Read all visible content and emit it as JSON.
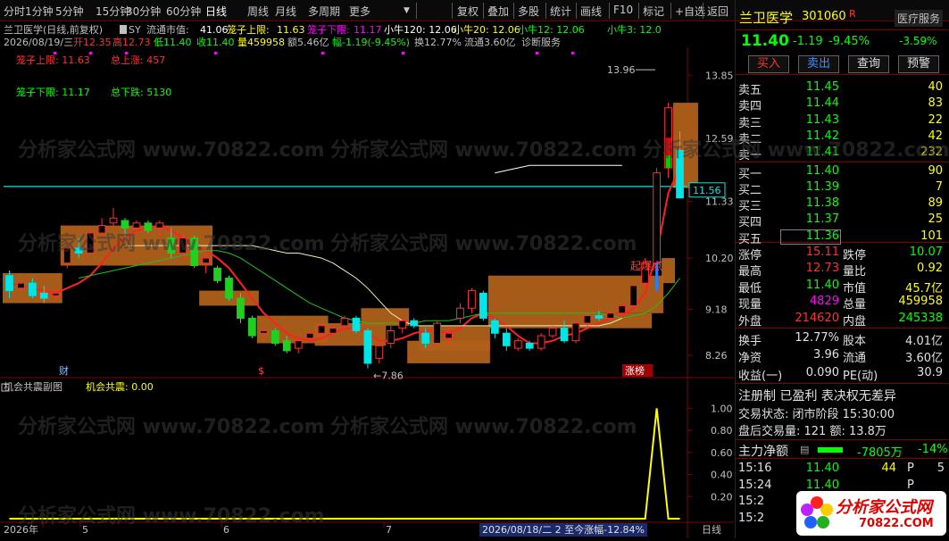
{
  "toolbar": {
    "left": [
      "分时",
      "1分钟",
      "5分钟",
      "15分钟",
      "30分钟",
      "60分钟",
      "日线",
      "周线",
      "月线",
      "多周期",
      "更多"
    ],
    "right": [
      "复权",
      "叠加",
      "多股",
      "统计",
      "画线",
      "F10",
      "标记",
      "+自选",
      "返回"
    ],
    "active": "日线"
  },
  "header": {
    "line1": {
      "name": "兰卫医学(日线,前复权)",
      "sy": "SY",
      "float_mv_label": "流通市值:",
      "float_mv": "41.06",
      "upper_label": "笼子上限:",
      "upper": "11.63",
      "lower_label": "笼子下限:",
      "lower": "11.17",
      "ma120": "小牛120: 12.06",
      "ma20": "小牛20: 12.06",
      "ma12": "小牛12: 12.06",
      "ma3": "小牛3: 12.0"
    },
    "line2": {
      "date": "2026/08/19/三",
      "open": "开12.35",
      "high": "高12.73",
      "low": "低11.40",
      "close": "收11.40",
      "vol": "量459958",
      "amt": "额5.46亿",
      "chg": "幅-1.19(-9.45%)",
      "turn": "换12.77%",
      "float": "流通3.60亿",
      "diag": "诊断服务"
    },
    "line3": {
      "upper_label": "笼子上限: 11.63",
      "up_total": "总上涨: 457"
    },
    "line4": {
      "lower_label": "笼子下限: 11.17",
      "down_total": "总下跌: 5130"
    }
  },
  "chart_data": [
    {
      "type": "candlestick",
      "title": "兰卫医学(日线,前复权)",
      "ylim": [
        7.6,
        14.3
      ],
      "y_ticks": [
        "13.85",
        "12.59",
        "11.33",
        "10.20",
        "9.18",
        "8.26"
      ],
      "price_marker": "11.56",
      "annotations": {
        "high_label": "13.96",
        "low_label": "7.86",
        "breakout": "起爆点",
        "bottom_labels": [
          "财",
          "$",
          "涨榜"
        ]
      },
      "candles": [
        {
          "o": 9.85,
          "h": 9.95,
          "l": 9.4,
          "c": 9.55
        },
        {
          "o": 9.6,
          "h": 9.9,
          "l": 9.5,
          "c": 9.7
        },
        {
          "o": 9.7,
          "h": 9.8,
          "l": 9.4,
          "c": 9.45
        },
        {
          "o": 9.5,
          "h": 9.65,
          "l": 9.3,
          "c": 9.4
        },
        {
          "o": 9.45,
          "h": 9.6,
          "l": 9.35,
          "c": 9.5
        },
        {
          "o": 10.1,
          "h": 10.6,
          "l": 10.0,
          "c": 10.4
        },
        {
          "o": 10.4,
          "h": 10.6,
          "l": 10.2,
          "c": 10.3
        },
        {
          "o": 10.3,
          "h": 10.8,
          "l": 10.25,
          "c": 10.7
        },
        {
          "o": 10.7,
          "h": 11.0,
          "l": 10.6,
          "c": 10.85
        },
        {
          "o": 10.9,
          "h": 11.2,
          "l": 10.8,
          "c": 11.0
        },
        {
          "o": 10.95,
          "h": 11.0,
          "l": 10.6,
          "c": 10.8
        },
        {
          "o": 10.8,
          "h": 10.95,
          "l": 10.7,
          "c": 10.9
        },
        {
          "o": 10.9,
          "h": 10.95,
          "l": 10.7,
          "c": 10.75
        },
        {
          "o": 10.8,
          "h": 10.95,
          "l": 10.65,
          "c": 10.9
        },
        {
          "o": 10.6,
          "h": 10.8,
          "l": 10.2,
          "c": 10.3
        },
        {
          "o": 10.3,
          "h": 10.7,
          "l": 10.2,
          "c": 10.6
        },
        {
          "o": 10.6,
          "h": 10.65,
          "l": 10.0,
          "c": 10.05
        },
        {
          "o": 10.1,
          "h": 10.3,
          "l": 9.9,
          "c": 10.2
        },
        {
          "o": 10.0,
          "h": 10.05,
          "l": 9.7,
          "c": 9.75
        },
        {
          "o": 9.8,
          "h": 9.85,
          "l": 9.35,
          "c": 9.4
        },
        {
          "o": 9.4,
          "h": 9.5,
          "l": 8.9,
          "c": 9.0
        },
        {
          "o": 9.0,
          "h": 9.05,
          "l": 8.6,
          "c": 8.65
        },
        {
          "o": 8.7,
          "h": 8.8,
          "l": 8.5,
          "c": 8.75
        },
        {
          "o": 8.75,
          "h": 8.8,
          "l": 8.45,
          "c": 8.5
        },
        {
          "o": 8.55,
          "h": 8.65,
          "l": 8.3,
          "c": 8.35
        },
        {
          "o": 8.4,
          "h": 8.6,
          "l": 8.3,
          "c": 8.55
        },
        {
          "o": 8.6,
          "h": 8.75,
          "l": 8.5,
          "c": 8.7
        },
        {
          "o": 8.7,
          "h": 8.9,
          "l": 8.6,
          "c": 8.85
        },
        {
          "o": 8.7,
          "h": 8.9,
          "l": 8.6,
          "c": 8.8
        },
        {
          "o": 8.85,
          "h": 9.05,
          "l": 8.8,
          "c": 9.0
        },
        {
          "o": 9.0,
          "h": 9.05,
          "l": 8.7,
          "c": 8.75
        },
        {
          "o": 8.75,
          "h": 8.8,
          "l": 8.0,
          "c": 8.1
        },
        {
          "o": 8.2,
          "h": 8.5,
          "l": 8.1,
          "c": 8.45
        },
        {
          "o": 8.5,
          "h": 8.85,
          "l": 8.4,
          "c": 8.75
        },
        {
          "o": 8.8,
          "h": 9.0,
          "l": 8.7,
          "c": 8.95
        },
        {
          "o": 8.95,
          "h": 9.0,
          "l": 8.8,
          "c": 8.85
        },
        {
          "o": 8.7,
          "h": 8.8,
          "l": 8.4,
          "c": 8.5
        },
        {
          "o": 8.5,
          "h": 8.95,
          "l": 8.45,
          "c": 8.9
        },
        {
          "o": 8.6,
          "h": 8.8,
          "l": 8.5,
          "c": 8.7
        },
        {
          "o": 9.0,
          "h": 9.3,
          "l": 8.9,
          "c": 9.2
        },
        {
          "o": 9.2,
          "h": 9.6,
          "l": 9.1,
          "c": 9.55
        },
        {
          "o": 9.5,
          "h": 9.55,
          "l": 8.95,
          "c": 9.0
        },
        {
          "o": 8.95,
          "h": 9.0,
          "l": 8.6,
          "c": 8.7
        },
        {
          "o": 8.7,
          "h": 8.8,
          "l": 8.35,
          "c": 8.45
        },
        {
          "o": 8.4,
          "h": 8.6,
          "l": 8.35,
          "c": 8.55
        },
        {
          "o": 8.5,
          "h": 8.55,
          "l": 8.35,
          "c": 8.4
        },
        {
          "o": 8.4,
          "h": 8.7,
          "l": 8.35,
          "c": 8.65
        },
        {
          "o": 8.65,
          "h": 8.85,
          "l": 8.6,
          "c": 8.8
        },
        {
          "o": 8.8,
          "h": 8.95,
          "l": 8.5,
          "c": 8.55
        },
        {
          "o": 8.55,
          "h": 8.95,
          "l": 8.5,
          "c": 8.9
        },
        {
          "o": 8.9,
          "h": 9.1,
          "l": 8.8,
          "c": 9.05
        },
        {
          "o": 9.05,
          "h": 9.15,
          "l": 8.95,
          "c": 9.0
        },
        {
          "o": 9.0,
          "h": 9.15,
          "l": 8.95,
          "c": 9.1
        },
        {
          "o": 9.1,
          "h": 9.3,
          "l": 9.05,
          "c": 9.25
        },
        {
          "o": 9.25,
          "h": 9.7,
          "l": 9.2,
          "c": 9.65
        },
        {
          "o": 9.7,
          "h": 10.2,
          "l": 9.6,
          "c": 10.1
        },
        {
          "o": 10.1,
          "h": 12.0,
          "l": 10.0,
          "c": 11.9
        },
        {
          "o": 12.0,
          "h": 13.3,
          "l": 11.8,
          "c": 13.2
        },
        {
          "o": 12.35,
          "h": 12.73,
          "l": 11.4,
          "c": 11.4
        }
      ],
      "series": [
        {
          "name": "小牛3",
          "values": [
            9.7,
            9.65,
            9.6,
            9.55,
            9.5,
            9.6,
            9.7,
            9.85,
            10.1,
            10.4,
            10.6,
            10.75,
            10.8,
            10.85,
            10.75,
            10.6,
            10.45,
            10.35,
            10.2,
            10.0,
            9.7,
            9.4,
            9.1,
            8.9,
            8.7,
            8.6,
            8.55,
            8.6,
            8.7,
            8.8,
            8.8,
            8.7,
            8.55,
            8.55,
            8.6,
            8.7,
            8.75,
            8.75,
            8.7,
            8.8,
            9.0,
            9.1,
            9.0,
            8.85,
            8.65,
            8.5,
            8.5,
            8.55,
            8.65,
            8.7,
            8.8,
            8.9,
            9.0,
            9.05,
            9.2,
            9.5,
            10.3,
            11.5,
            12.0
          ]
        },
        {
          "name": "小牛20",
          "values": [
            null,
            null,
            null,
            null,
            null,
            null,
            9.8,
            9.85,
            9.9,
            9.95,
            10.0,
            10.05,
            10.1,
            10.15,
            10.2,
            10.25,
            10.3,
            10.35,
            10.35,
            10.3,
            10.2,
            10.05,
            9.9,
            9.75,
            9.6,
            9.45,
            9.3,
            9.2,
            9.1,
            9.0,
            8.95,
            8.9,
            8.9,
            8.9,
            8.9,
            8.9,
            8.95,
            8.95,
            8.95,
            9.0,
            9.05,
            9.1,
            9.1,
            9.1,
            9.1,
            9.1,
            9.1,
            9.1,
            9.1,
            9.1,
            9.1,
            9.1,
            9.05,
            9.0,
            9.05,
            9.1,
            9.25,
            9.5,
            9.8
          ]
        },
        {
          "name": "小牛120",
          "values": [
            null,
            null,
            null,
            null,
            null,
            null,
            null,
            null,
            null,
            null,
            10.45,
            10.45,
            10.45,
            10.45,
            10.45,
            10.45,
            10.45,
            10.45,
            10.45,
            10.45,
            10.45,
            10.45,
            10.4,
            10.35,
            10.3,
            10.3,
            10.25,
            10.2,
            10.1,
            9.95,
            9.8,
            9.6,
            9.35,
            9.1,
            8.95,
            8.85,
            8.85,
            8.85,
            8.85,
            8.85,
            8.85,
            8.85,
            8.85,
            8.85,
            8.85,
            8.85,
            8.85,
            8.85,
            8.85,
            8.85,
            8.85,
            8.85,
            8.9,
            9.0,
            null,
            null,
            null,
            null,
            null
          ]
        },
        {
          "name": "小牛12",
          "values": [
            null,
            null,
            null,
            null,
            null,
            null,
            null,
            null,
            null,
            null,
            null,
            null,
            null,
            null,
            null,
            null,
            null,
            null,
            null,
            null,
            null,
            null,
            null,
            null,
            null,
            null,
            null,
            null,
            null,
            null,
            null,
            null,
            null,
            null,
            null,
            null,
            null,
            null,
            null,
            null,
            null,
            null,
            11.9,
            11.95,
            12.0,
            12.05,
            12.05,
            12.05,
            12.05,
            12.05,
            12.05,
            12.05,
            12.05,
            12.05,
            null,
            null,
            null,
            null,
            null
          ]
        }
      ],
      "hline": 11.63,
      "boxes": [
        {
          "from": 0,
          "to": 4,
          "lo": 9.3,
          "hi": 9.9
        },
        {
          "from": 5,
          "to": 17,
          "lo": 10.05,
          "hi": 10.85
        },
        {
          "from": 17,
          "to": 21,
          "lo": 9.25,
          "hi": 9.55
        },
        {
          "from": 22,
          "to": 27,
          "lo": 8.5,
          "hi": 9.05
        },
        {
          "from": 27,
          "to": 32,
          "lo": 8.45,
          "hi": 8.9
        },
        {
          "from": 31,
          "to": 34,
          "lo": 8.85,
          "hi": 9.2
        },
        {
          "from": 35,
          "to": 41,
          "lo": 8.1,
          "hi": 8.55
        },
        {
          "from": 36,
          "to": 41,
          "lo": 8.35,
          "hi": 8.85
        },
        {
          "from": 42,
          "to": 56,
          "lo": 9.1,
          "hi": 9.85
        },
        {
          "from": 42,
          "to": 55,
          "lo": 8.8,
          "hi": 9.1
        },
        {
          "from": 57,
          "to": 57,
          "lo": 9.7,
          "hi": 10.2
        },
        {
          "from": 58,
          "to": 59,
          "lo": 11.6,
          "hi": 13.3
        }
      ]
    },
    {
      "type": "line",
      "title": "机会共震副图",
      "series": [
        {
          "name": "机会共震",
          "values": [
            0,
            0,
            0,
            0,
            0,
            0,
            0,
            0,
            0,
            0,
            0,
            0,
            0,
            0,
            0,
            0,
            0,
            0,
            0,
            0,
            0,
            0,
            0,
            0,
            0,
            0,
            0,
            0,
            0,
            0,
            0,
            0,
            0,
            0,
            0,
            0,
            0,
            0,
            0,
            0,
            0,
            0,
            0,
            0,
            0,
            0,
            0,
            0,
            0,
            0,
            0,
            0,
            0,
            0,
            0,
            0,
            1,
            0,
            0
          ]
        }
      ],
      "ylim": [
        0,
        1.1
      ],
      "y_ticks": [
        "1.00",
        "0.80",
        "0.60",
        "0.40",
        "0.20"
      ],
      "x_labels": [
        "2026年",
        "5",
        "6",
        "7"
      ],
      "footer": "2026/08/18/二 2 至今涨幅-12.84%",
      "period": "日线"
    }
  ],
  "subchart": {
    "title": "机会共震副图",
    "label": "机会共震: 0.00"
  },
  "right_panel": {
    "name": "兰卫医学",
    "code": "301060",
    "r": "R",
    "service": "医疗服务",
    "price": "11.40",
    "change": "-1.19",
    "pct": "-9.45%",
    "sector_pct": "-3.59%",
    "buttons": [
      "买入",
      "卖出",
      "查询",
      "预警"
    ],
    "asks": [
      {
        "label": "卖五",
        "price": "11.45",
        "vol": "40"
      },
      {
        "label": "卖四",
        "price": "11.44",
        "vol": "83"
      },
      {
        "label": "卖三",
        "price": "11.43",
        "vol": "22"
      },
      {
        "label": "卖二",
        "price": "11.42",
        "vol": "42"
      },
      {
        "label": "卖一",
        "price": "11.41",
        "vol": "232"
      }
    ],
    "bids": [
      {
        "label": "买一",
        "price": "11.40",
        "vol": "90"
      },
      {
        "label": "买二",
        "price": "11.39",
        "vol": "7"
      },
      {
        "label": "买三",
        "price": "11.38",
        "vol": "89"
      },
      {
        "label": "买四",
        "price": "11.37",
        "vol": "25"
      },
      {
        "label": "买五",
        "price": "11.36",
        "vol": "101"
      }
    ],
    "stats": [
      {
        "l1": "涨停",
        "v1": "15.11",
        "l2": "跌停",
        "v2": "10.07"
      },
      {
        "l1": "最高",
        "v1": "12.73",
        "l2": "量比",
        "v2": "0.92"
      },
      {
        "l1": "最低",
        "v1": "11.40",
        "l2": "市值",
        "v2": "45.7亿"
      },
      {
        "l1": "现量",
        "v1": "4829",
        "l2": "总量",
        "v2": "459958"
      },
      {
        "l1": "外盘",
        "v1": "214620",
        "l2": "内盘",
        "v2": "245338"
      }
    ],
    "stats2": [
      {
        "l1": "换手",
        "v1": "12.77%",
        "l2": "股本",
        "v2": "4.01亿"
      },
      {
        "l1": "净资",
        "v1": "3.96",
        "l2": "流通",
        "v2": "3.60亿"
      },
      {
        "l1": "收益(一)",
        "v1": "0.090",
        "l2": "PE(动)",
        "v2": "30.9"
      }
    ],
    "info1": "注册制 已盈利 表决权无差异",
    "info2_label": "交易状态:",
    "info2": "闭市阶段 15:30:00",
    "info3": "盘后交易量: 121  额: 13.8万",
    "main_flow_label": "主力净额",
    "main_flow": "-7805万",
    "main_flow_pct": "-14%",
    "ticks": [
      {
        "time": "15:16",
        "price": "11.40",
        "vol": "44",
        "flag": "P",
        "n": "5"
      },
      {
        "time": "15:24",
        "price": "11.40",
        "vol": "",
        "flag": "P",
        "n": ""
      },
      {
        "time": "15:2",
        "price": "",
        "vol": "",
        "flag": "",
        "n": ""
      },
      {
        "time": "15:2",
        "price": "",
        "vol": "",
        "flag": "",
        "n": ""
      }
    ],
    "logo_text": "分析家公式网",
    "logo_sub": "70822.COM"
  },
  "watermark": "分析家公式网 www.70822.com"
}
